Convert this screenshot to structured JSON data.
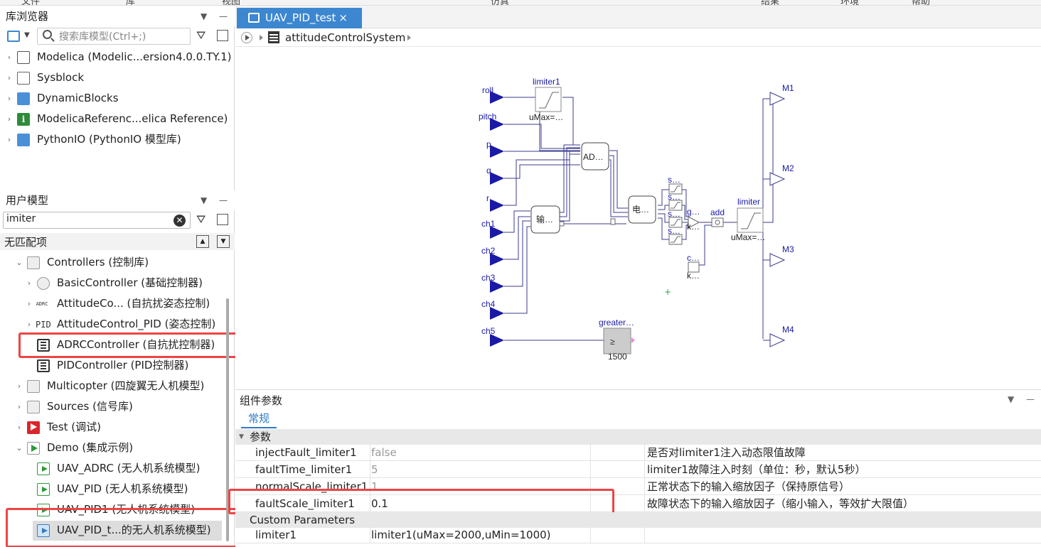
{
  "menu_bar": [
    "文件",
    "库",
    "视图",
    "仿真",
    "结果",
    "环境",
    "帮助"
  ],
  "library_browser": {
    "title": "库浏览器",
    "search_placeholder": "搜索库模型(Ctrl+;)",
    "items": [
      {
        "label": "Modelica (Modelic...ersion4.0.0.TY.1)",
        "icon": "modelica-icon"
      },
      {
        "label": "Sysblock",
        "icon": "sysblock-icon"
      },
      {
        "label": "DynamicBlocks",
        "icon": "folder-icon"
      },
      {
        "label": "ModelicaReferenc...elica Reference)",
        "icon": "info-icon"
      },
      {
        "label": "PythonIO (PythonIO 模型库)",
        "icon": "folder-icon"
      }
    ]
  },
  "user_models": {
    "title": "用户模型",
    "search_value": "imiter",
    "no_match_text": "无匹配项",
    "items": [
      {
        "label": "Controllers (控制库)",
        "level": 1,
        "expanded": true
      },
      {
        "label": "BasicController (基础控制器)",
        "level": 2
      },
      {
        "label": "AttitudeCo... (自抗扰姿态控制)",
        "level": 2,
        "icon_text": "ADRC"
      },
      {
        "label": "AttitudeControl_PID (姿态控制)",
        "level": 2,
        "icon_text": "PID"
      },
      {
        "label": "ADRCController (自抗扰控制器)",
        "level": 2,
        "highlighted": true
      },
      {
        "label": "PIDController (PID控制器)",
        "level": 2
      },
      {
        "label": "Multicopter (四旋翼无人机模型)",
        "level": 1
      },
      {
        "label": "Sources (信号库)",
        "level": 1
      },
      {
        "label": "Test (调试)",
        "level": 1
      },
      {
        "label": "Demo (集成示例)",
        "level": 1,
        "expanded": true
      },
      {
        "label": "UAV_ADRC (无人机系统模型)",
        "level": 2
      },
      {
        "label": "UAV_PID (无人机系统模型)",
        "level": 2
      },
      {
        "label": "UAV_PID1 (无人机系统模型)",
        "level": 2
      },
      {
        "label": "UAV_PID_t...的无人机系统模型)",
        "level": 2,
        "selected": true
      }
    ]
  },
  "editor": {
    "tab_label": "UAV_PID_test",
    "tab_close": "×",
    "breadcrumb": "attitudeControlSystem"
  },
  "diagram": {
    "inputs": [
      "roll",
      "pitch",
      "p",
      "q",
      "r",
      "ch1",
      "ch2",
      "ch3",
      "ch4",
      "ch5"
    ],
    "outputs": [
      "M1",
      "M2",
      "M3",
      "M4"
    ],
    "blocks": {
      "limiter1_name": "limiter1",
      "limiter1_param": "uMax=…",
      "adrc": "AD…",
      "input_block": "输…",
      "motor_block": "电…",
      "s_labels": [
        "s…",
        "s…",
        "s…",
        "s…"
      ],
      "g_label": "g…",
      "k_label": "k…",
      "add_label": "add",
      "limiter_name": "limiter",
      "limiter_param": "uMax=…",
      "c_label": "c…",
      "k2_label": "k…",
      "greater_name": "greater…",
      "greater_symbol": "≥",
      "greater_value": "1500"
    },
    "line_color": "#3b3b8f",
    "block_blue": "#1a1aa6"
  },
  "params": {
    "title": "组件参数",
    "tab": "常规",
    "group1": "参数",
    "rows": [
      {
        "name": "injectFault_limiter1",
        "value": "false",
        "desc": "是否对limiter1注入动态限值故障",
        "gray": true
      },
      {
        "name": "faultTime_limiter1",
        "value": "5",
        "desc": "limiter1故障注入时刻（单位：秒，默认5秒）",
        "gray": true
      },
      {
        "name": "normalScale_limiter1",
        "value": "1",
        "desc": "正常状态下的输入缩放因子（保持原信号）",
        "gray": true
      },
      {
        "name": "faultScale_limiter1",
        "value": "0.1",
        "desc": "故障状态下的输入缩放因子（缩小输入，等效扩大限值）",
        "gray": false
      }
    ],
    "group2": "Custom Parameters",
    "custom_rows": [
      {
        "name": "limiter1",
        "value": "limiter1(uMax=2000,uMin=1000)",
        "desc": ""
      }
    ]
  },
  "colors": {
    "accent": "#3c87d0",
    "highlight": "#ee4444"
  }
}
